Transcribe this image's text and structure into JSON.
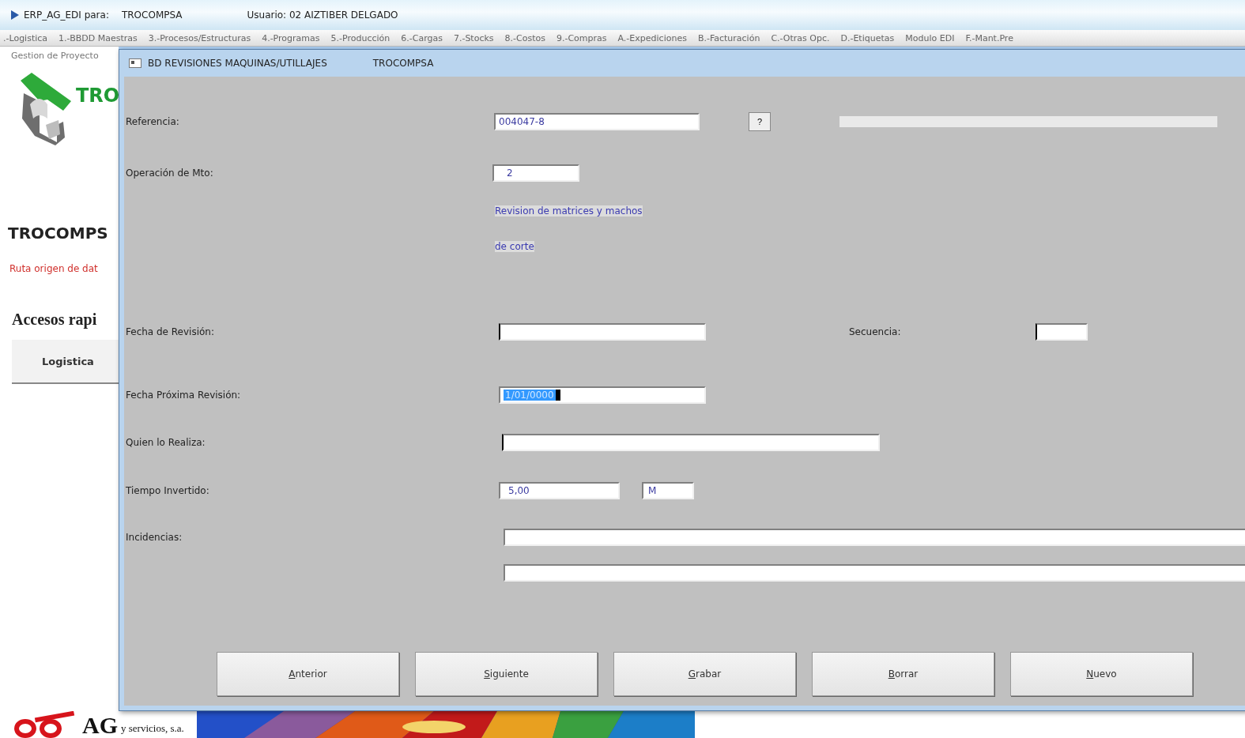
{
  "window": {
    "title": "ERP_AG_EDI para:",
    "company": "TROCOMPSA",
    "user": "Usuario: 02 AIZTIBER DELGADO"
  },
  "menu": [
    {
      "label": ".-Logistica"
    },
    {
      "label": "1.-BBDD Maestras"
    },
    {
      "label": "3.-Procesos/Estructuras"
    },
    {
      "label": "4.-Programas"
    },
    {
      "label": "5.-Producción"
    },
    {
      "label": "6.-Cargas"
    },
    {
      "label": "7.-Stocks"
    },
    {
      "label": "8.-Costos"
    },
    {
      "label": "9.-Compras"
    },
    {
      "label": "A.-Expediciones"
    },
    {
      "label": "B.-Facturación"
    },
    {
      "label": "C.-Otras Opc."
    },
    {
      "label": "D.-Etiquetas"
    },
    {
      "label": "Modulo EDI"
    },
    {
      "label": "F.-Mant.Pre"
    }
  ],
  "background_page": {
    "toolbar_item": "Gestion de Proyecto",
    "logo_text": "TRO",
    "heading": "TROCOMPS",
    "path_label": "Ruta origen de dat",
    "section_title": "Accesos rapi",
    "quick_access_button": "Logistica",
    "footer_brand": "AG",
    "footer_tagline": "y servicios, s.a."
  },
  "dialog": {
    "title": "BD REVISIONES MAQUINAS/UTILLAJES",
    "company": "TROCOMPSA",
    "reference": {
      "label": "Referencia:",
      "value": "004047-8",
      "lookup": "?"
    },
    "operation": {
      "label": "Operación de Mto:",
      "value": "2",
      "description": [
        "Revision de matrices y machos",
        "de corte"
      ]
    },
    "revision_date": {
      "label": "Fecha de Revisión:"
    },
    "sequence": {
      "label": "Secuencia:"
    },
    "next_revision_date": {
      "label": "Fecha Próxima Revisión:",
      "value": "1/01/0000",
      "selected": true
    },
    "performed_by": {
      "label": "Quien lo Realiza:"
    },
    "time_spent": {
      "label": "Tiempo Invertido:",
      "value": "5,00",
      "unit": "M"
    },
    "incidents": {
      "label": "Incidencias:"
    },
    "buttons": [
      "Anterior",
      "Siguiente",
      "Grabar",
      "Borrar",
      "Nuevo"
    ]
  }
}
